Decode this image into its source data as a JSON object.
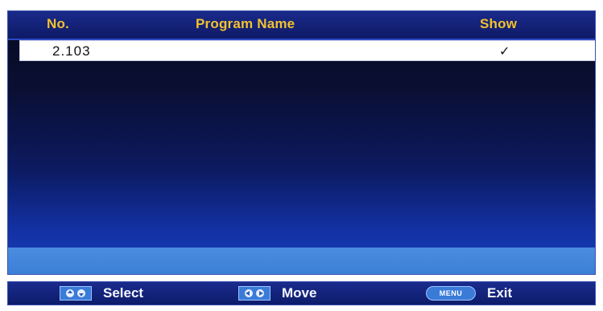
{
  "table": {
    "headers": {
      "no": "No.",
      "program_name": "Program Name",
      "show": "Show"
    },
    "rows": [
      {
        "no": "2.103",
        "program_name": "",
        "show": "✓"
      }
    ]
  },
  "footer": {
    "select_label": "Select",
    "move_label": "Move",
    "exit_label": "Exit",
    "menu_key_label": "MENU",
    "select_icon": "up-down-arrows-icon",
    "move_icon": "left-right-arrows-icon",
    "exit_icon": "menu-key-icon"
  },
  "colors": {
    "header_text": "#f2c12e",
    "panel_bg": "#0c1a60",
    "row_bg": "#ffffff",
    "status_strip": "#3b7fd6"
  }
}
